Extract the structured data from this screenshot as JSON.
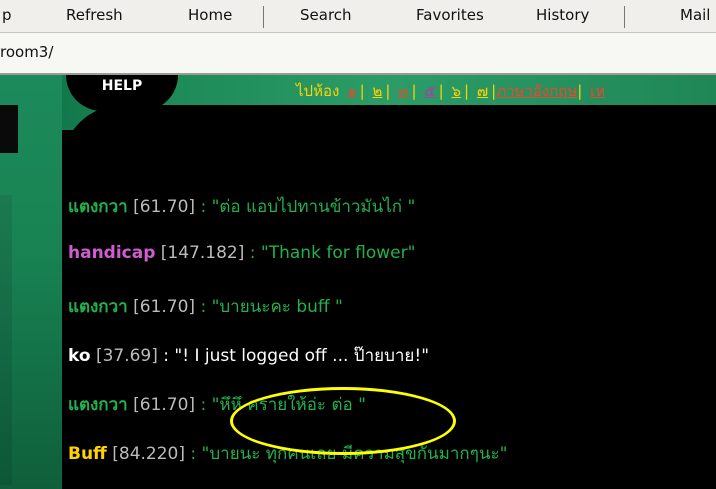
{
  "toolbar": {
    "items": [
      "p",
      "Refresh",
      "Home",
      "Search",
      "Favorites",
      "History",
      "Mail"
    ]
  },
  "address": {
    "value": "room3/"
  },
  "page": {
    "help_label": "HELP",
    "roomnav": {
      "prefix": "ไปห้อง",
      "rooms": [
        "๑",
        "๒",
        "๓",
        "๕",
        "๖",
        "๗"
      ],
      "english_room": "ภาษาอังกฤษ",
      "trailing": "เห"
    },
    "messages": [
      {
        "nick": "แตงกวา",
        "ip": "[61.70]",
        "text": ": \"ต่อ แอบไปทานข้าวมันไก่ \"",
        "nick_color": "#22b14c",
        "text_color": "#22b14c"
      },
      {
        "nick": "handicap",
        "ip": "[147.182]",
        "text": ": \"Thank for flower\"",
        "nick_color": "#d05cd0",
        "text_color": "#22b14c"
      },
      {
        "nick": "แตงกวา",
        "ip": "[61.70]",
        "text": ": \"บายนะคะ buff \"",
        "nick_color": "#22b14c",
        "text_color": "#22b14c"
      },
      {
        "nick": "ko",
        "ip": "[37.69]",
        "text": ": \"! I just logged off ... ป๊ายบาย!\"",
        "nick_color": "#ffffff",
        "text_color": "#ffffff"
      },
      {
        "nick": "แตงกวา",
        "ip": "[61.70]",
        "text": ": \"หึหึ ครายให้อ่ะ ต่อ \"",
        "nick_color": "#22b14c",
        "text_color": "#22b14c"
      },
      {
        "nick": "Buff",
        "ip": "[84.220]",
        "text": ": \"บายนะ ทุกคนเลย มีความสุขกันมากๆนะ\"",
        "nick_color": "#ffd200",
        "text_color": "#22b14c"
      }
    ],
    "highlight_color": "#ffff00"
  }
}
